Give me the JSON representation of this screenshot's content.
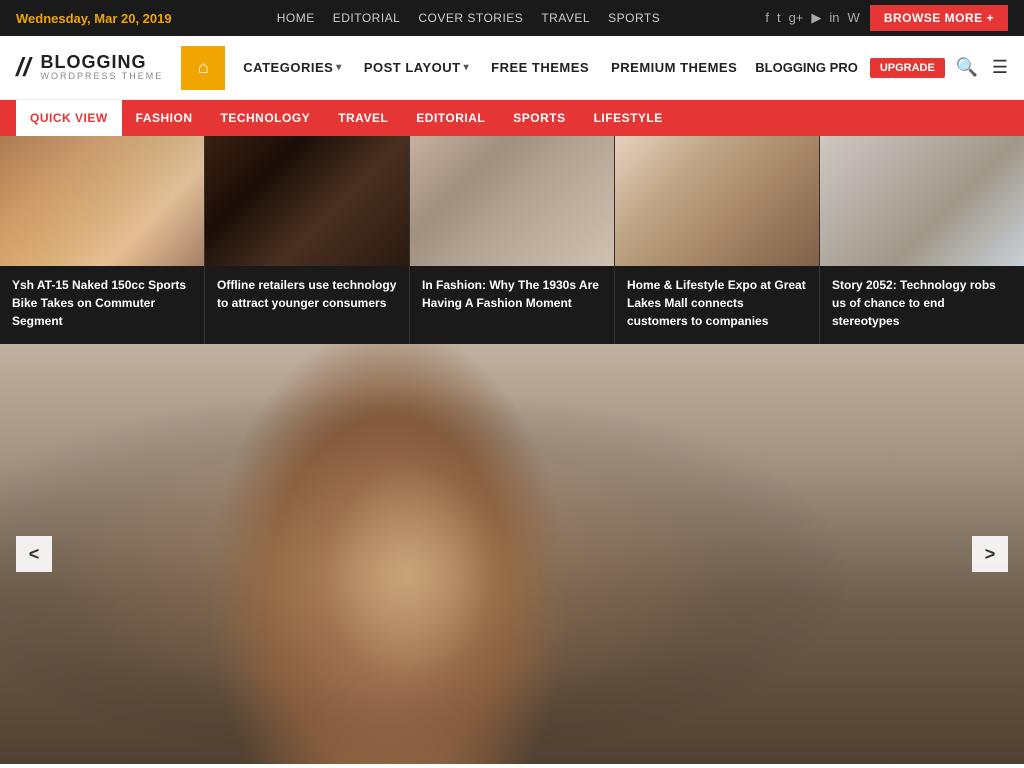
{
  "topbar": {
    "date": "Wednesday, Mar 20, 2019",
    "nav": [
      "HOME",
      "EDITORIAL",
      "COVER STORIES",
      "TRAVEL",
      "SPORTS"
    ],
    "browse_btn": "BROWSE MORE +",
    "social": [
      "f",
      "t",
      "g",
      "▶",
      "in",
      "W"
    ]
  },
  "mainnav": {
    "logo_main": "BLOGGING",
    "logo_sub": "WORDPRESS THEME",
    "home_icon": "⌂",
    "links": [
      {
        "label": "CATEGORIES",
        "has_arrow": true
      },
      {
        "label": "POST LAYOUT",
        "has_arrow": true
      },
      {
        "label": "FREE THEMES",
        "has_arrow": false
      },
      {
        "label": "PREMIUM THEMES",
        "has_arrow": false
      },
      {
        "label": "BLOGGING PRO",
        "has_arrow": false
      }
    ],
    "upgrade_label": "UPGRADE",
    "search_icon": "🔍",
    "menu_icon": "☰"
  },
  "catbar": {
    "items": [
      "QUICK VIEW",
      "FASHION",
      "TECHNOLOGY",
      "TRAVEL",
      "EDITORIAL",
      "SPORTS",
      "LIFESTYLE"
    ]
  },
  "articles": [
    {
      "title": "Ysh AT-15 Naked 150cc Sports Bike Takes on Commuter Segment",
      "img_class": "img-motocross"
    },
    {
      "title": "Offline retailers use technology to attract younger consumers",
      "img_class": "img-phone"
    },
    {
      "title": "In Fashion: Why The 1930s Are Having A Fashion Moment",
      "img_class": "img-fashion"
    },
    {
      "title": "Home & Lifestyle Expo at Great Lakes Mall connects customers to companies",
      "img_class": "img-lifestyle"
    },
    {
      "title": "Story 2052: Technology robs us of chance to end stereotypes",
      "img_class": "img-tech"
    }
  ],
  "slider": {
    "prev_label": "<",
    "next_label": ">"
  }
}
